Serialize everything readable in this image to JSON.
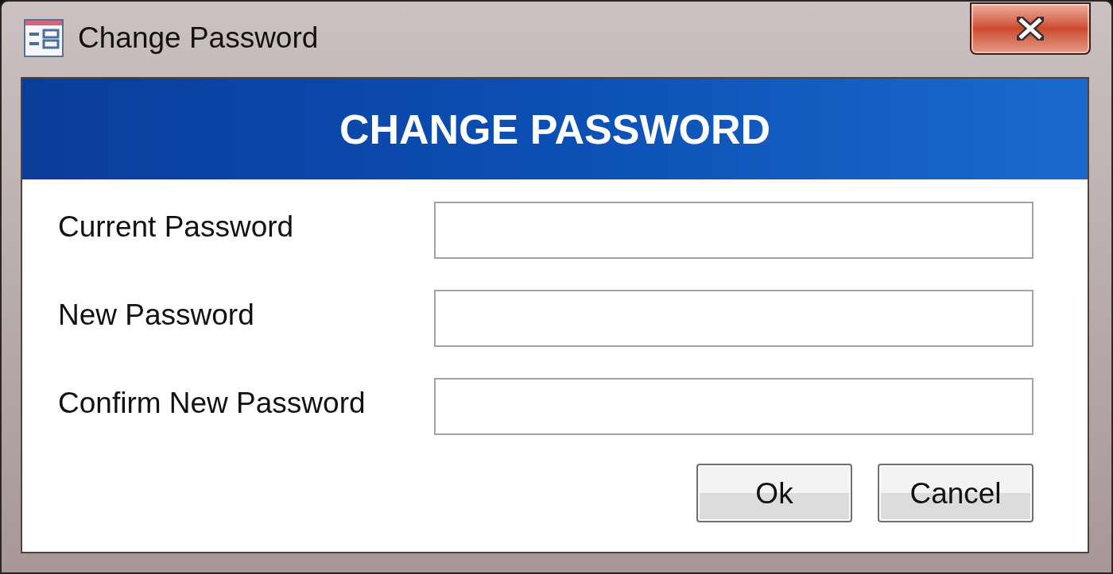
{
  "window": {
    "title": "Change Password"
  },
  "header": {
    "title": "CHANGE PASSWORD"
  },
  "fields": [
    {
      "label": "Current Password"
    },
    {
      "label": "New Password"
    },
    {
      "label": "Confirm New Password"
    }
  ],
  "buttons": [
    {
      "label": "Ok"
    },
    {
      "label": "Cancel"
    }
  ]
}
